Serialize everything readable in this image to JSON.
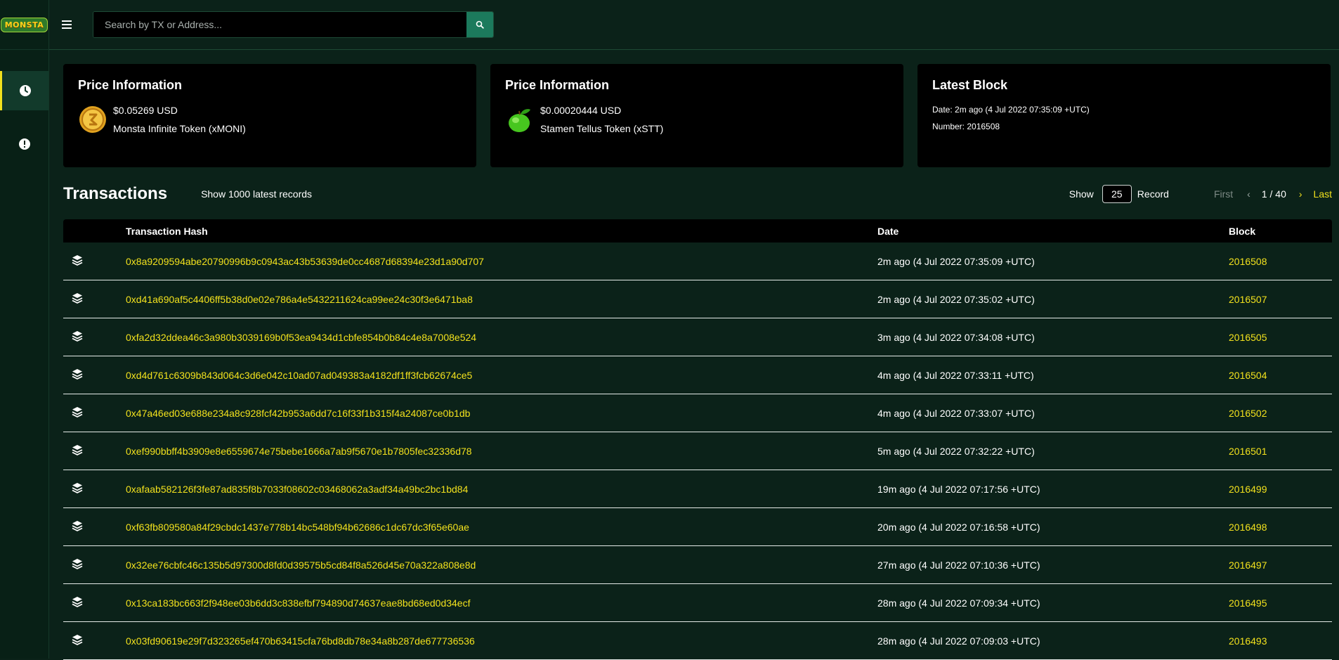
{
  "app": {
    "logo_text": "MONSTA"
  },
  "search": {
    "placeholder": "Search by TX or Address..."
  },
  "cards": [
    {
      "title": "Price Information",
      "price": "$0.05269 USD",
      "token": "Monsta Infinite Token (xMONI)"
    },
    {
      "title": "Price Information",
      "price": "$0.00020444 USD",
      "token": "Stamen Tellus Token (xSTT)"
    }
  ],
  "latest_block": {
    "title": "Latest Block",
    "date": "Date: 2m ago (4 Jul 2022 07:35:09 +UTC)",
    "number": "Number: 2016508"
  },
  "transactions": {
    "title": "Transactions",
    "subtitle": "Show 1000 latest records",
    "show_label": "Show",
    "record_count": "25",
    "record_label": "Record",
    "first_label": "First",
    "prev_icon": "‹",
    "page_position": "1 / 40",
    "next_icon": "›",
    "last_label": "Last",
    "columns": {
      "hash": "Transaction Hash",
      "date": "Date",
      "block": "Block"
    },
    "rows": [
      {
        "hash": "0x8a9209594abe20790996b9c0943ac43b53639de0cc4687d68394e23d1a90d707",
        "date": "2m ago (4 Jul 2022 07:35:09 +UTC)",
        "block": "2016508"
      },
      {
        "hash": "0xd41a690af5c4406ff5b38d0e02e786a4e5432211624ca99ee24c30f3e6471ba8",
        "date": "2m ago (4 Jul 2022 07:35:02 +UTC)",
        "block": "2016507"
      },
      {
        "hash": "0xfa2d32ddea46c3a980b3039169b0f53ea9434d1cbfe854b0b84c4e8a7008e524",
        "date": "3m ago (4 Jul 2022 07:34:08 +UTC)",
        "block": "2016505"
      },
      {
        "hash": "0xd4d761c6309b843d064c3d6e042c10ad07ad049383a4182df1ff3fcb62674ce5",
        "date": "4m ago (4 Jul 2022 07:33:11 +UTC)",
        "block": "2016504"
      },
      {
        "hash": "0x47a46ed03e688e234a8c928fcf42b953a6dd7c16f33f1b315f4a24087ce0b1db",
        "date": "4m ago (4 Jul 2022 07:33:07 +UTC)",
        "block": "2016502"
      },
      {
        "hash": "0xef990bbff4b3909e8e6559674e75bebe1666a7ab9f5670e1b7805fec32336d78",
        "date": "5m ago (4 Jul 2022 07:32:22 +UTC)",
        "block": "2016501"
      },
      {
        "hash": "0xafaab582126f3fe87ad835f8b7033f08602c03468062a3adf34a49bc2bc1bd84",
        "date": "19m ago (4 Jul 2022 07:17:56 +UTC)",
        "block": "2016499"
      },
      {
        "hash": "0xf63fb809580a84f29cbdc1437e778b14bc548bf94b62686c1dc67dc3f65e60ae",
        "date": "20m ago (4 Jul 2022 07:16:58 +UTC)",
        "block": "2016498"
      },
      {
        "hash": "0x32ee76cbfc46c135b5d97300d8fd0d39575b5cd84f8a526d45e70a322a808e8d",
        "date": "27m ago (4 Jul 2022 07:10:36 +UTC)",
        "block": "2016497"
      },
      {
        "hash": "0x13ca183bc663f2f948ee03b6dd3c838efbf794890d74637eae8bd68ed0d34ecf",
        "date": "28m ago (4 Jul 2022 07:09:34 +UTC)",
        "block": "2016495"
      },
      {
        "hash": "0x03fd90619e29f7d323265ef470b63415cfa76bd8db78e34a8b287de677736536",
        "date": "28m ago (4 Jul 2022 07:09:03 +UTC)",
        "block": "2016493"
      }
    ]
  },
  "colors": {
    "accent": "#f2e11d",
    "background": "#0b2219",
    "card": "#000000",
    "search_button": "#1c7a5c"
  },
  "icons": {
    "menu": "menu-icon",
    "search": "search-icon",
    "clock": "clock-icon",
    "alert": "alert-icon",
    "row": "layers-icon"
  }
}
